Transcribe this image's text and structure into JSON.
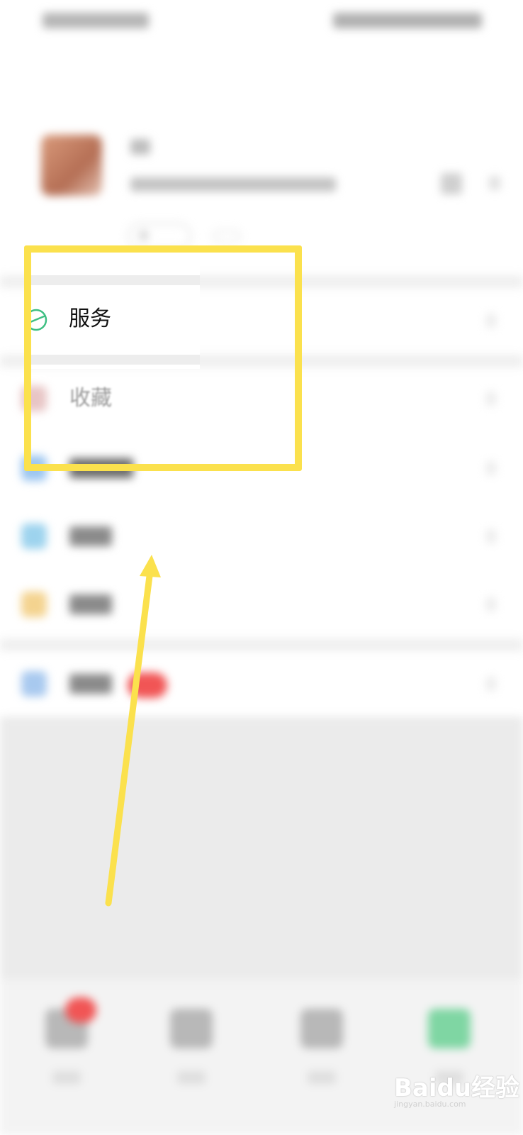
{
  "list": {
    "service_label": "服务",
    "favorites_label": "收藏"
  },
  "status_chip": {
    "plus": "+"
  },
  "watermark": {
    "brand": "Baidu经验",
    "url": "jingyan.baidu.com"
  },
  "colors": {
    "highlight": "#fbe14d",
    "service_icon": "#3fbf83",
    "badge_red": "#f15555"
  }
}
